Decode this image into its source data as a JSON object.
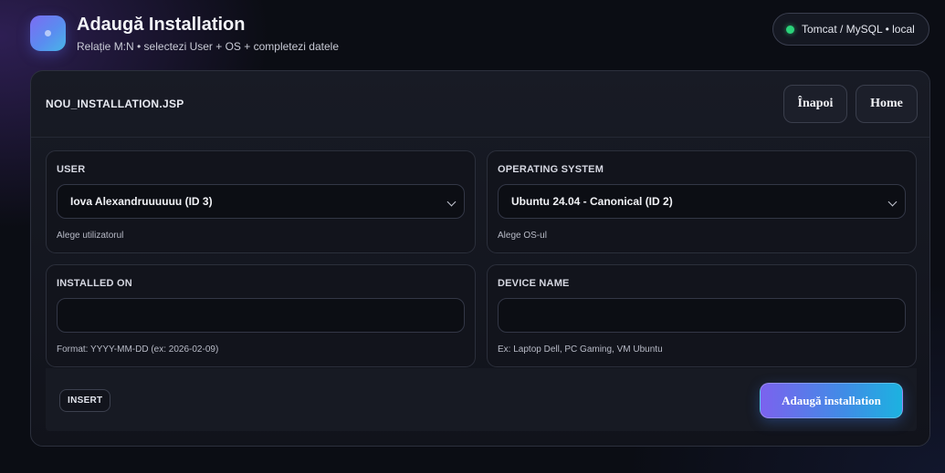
{
  "header": {
    "title": "Adaugă Installation",
    "subtitle": "Relație M:N • selectezi User + OS + completezi datele",
    "status": "Tomcat / MySQL • local"
  },
  "card": {
    "title": "NOU_INSTALLATION.JSP",
    "back_label": "Înapoi",
    "home_label": "Home"
  },
  "fields": {
    "user": {
      "label": "USER",
      "value": "Iova Alexandruuuuuu (ID 3)",
      "hint": "Alege utilizatorul"
    },
    "os": {
      "label": "OPERATING SYSTEM",
      "value": "Ubuntu 24.04 - Canonical (ID 2)",
      "hint": "Alege OS-ul"
    },
    "installed_on": {
      "label": "INSTALLED ON",
      "value": "",
      "placeholder": "",
      "hint": "Format: YYYY-MM-DD (ex: 2026-02-09)"
    },
    "device_name": {
      "label": "DEVICE NAME",
      "value": "",
      "placeholder": "",
      "hint": "Ex: Laptop Dell, PC Gaming, VM Ubuntu"
    }
  },
  "footer": {
    "badge": "INSERT",
    "submit_label": "Adaugă installation"
  },
  "colors": {
    "accent_start": "#7b62ee",
    "accent_end": "#1cb2e0",
    "status_ok": "#2bd27a",
    "background": "#0b0d14"
  },
  "icons": {
    "logo": "app-logo-icon",
    "status": "status-dot-icon",
    "select": "chevron-down-icon"
  }
}
